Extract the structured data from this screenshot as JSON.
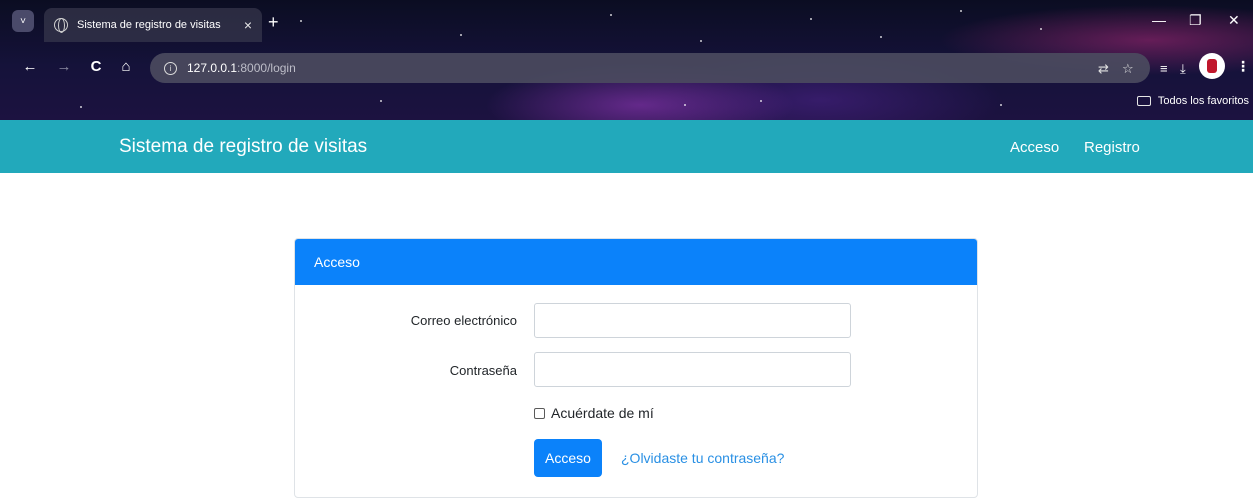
{
  "browser": {
    "tab_title": "Sistema de registro de visitas",
    "tab_close": "×",
    "new_tab": "+",
    "url_host": "127.0.0.1",
    "url_path": ":8000/login",
    "bookmarks_all": "Todos los favoritos",
    "icons": {
      "back": "←",
      "forward": "→",
      "reload": "C",
      "home": "⌂",
      "translate": "⇄",
      "star": "☆",
      "tab_search": "≡",
      "download": "⤓",
      "minimize": "—",
      "restore": "❐",
      "close": "✕",
      "menu": "⋮",
      "tab_menu": "˅",
      "info": "i"
    }
  },
  "navbar": {
    "brand": "Sistema de registro de visitas",
    "links": [
      "Acceso",
      "Registro"
    ],
    "color": "#22a9bb"
  },
  "card": {
    "header": "Acceso",
    "header_color": "#0b82fa",
    "email_label": "Correo electrónico",
    "email_value": "",
    "password_label": "Contraseña",
    "password_value": "",
    "remember_label": "Acuérdate de mí",
    "remember_checked": false,
    "submit_label": "Acceso",
    "forgot_label": "¿Olvidaste tu contraseña?"
  }
}
